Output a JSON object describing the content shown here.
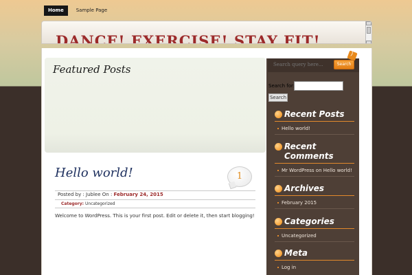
{
  "nav": {
    "items": [
      {
        "label": "Home",
        "active": true
      },
      {
        "label": "Sample Page",
        "active": false
      }
    ]
  },
  "header": {
    "site_title": "DANCE! EXERCISE! STAY FIT!"
  },
  "featured": {
    "heading": "Featured Posts"
  },
  "post": {
    "title": "Hello world!",
    "comment_count": "1",
    "posted_by_label": "Posted by :",
    "author": "Jublee",
    "on_label": "On :",
    "date": "February 24, 2015",
    "category_label": "Category:",
    "category": "Uncategorized",
    "content": "Welcome to WordPress. This is your first post. Edit or delete it, then start blogging!"
  },
  "sidebar": {
    "top_search_placeholder": "Search query here...",
    "top_search_button": "Search",
    "search_for_label": "Search for:",
    "search_button": "Search",
    "widgets": [
      {
        "title": "Recent Posts",
        "items": [
          "Hello world!"
        ]
      },
      {
        "title": "Recent Comments",
        "items": [
          "Mr WordPress on Hello world!"
        ]
      },
      {
        "title": "Archives",
        "items": [
          "February 2015"
        ]
      },
      {
        "title": "Categories",
        "items": [
          "Uncategorized"
        ]
      },
      {
        "title": "Meta",
        "items": [
          "Log in"
        ]
      }
    ]
  },
  "colors": {
    "title_red": "#9c2a2a",
    "accent_orange": "#e98a1c",
    "sidebar_brown": "#4e3f36",
    "post_title_blue": "#1d2f5e"
  }
}
